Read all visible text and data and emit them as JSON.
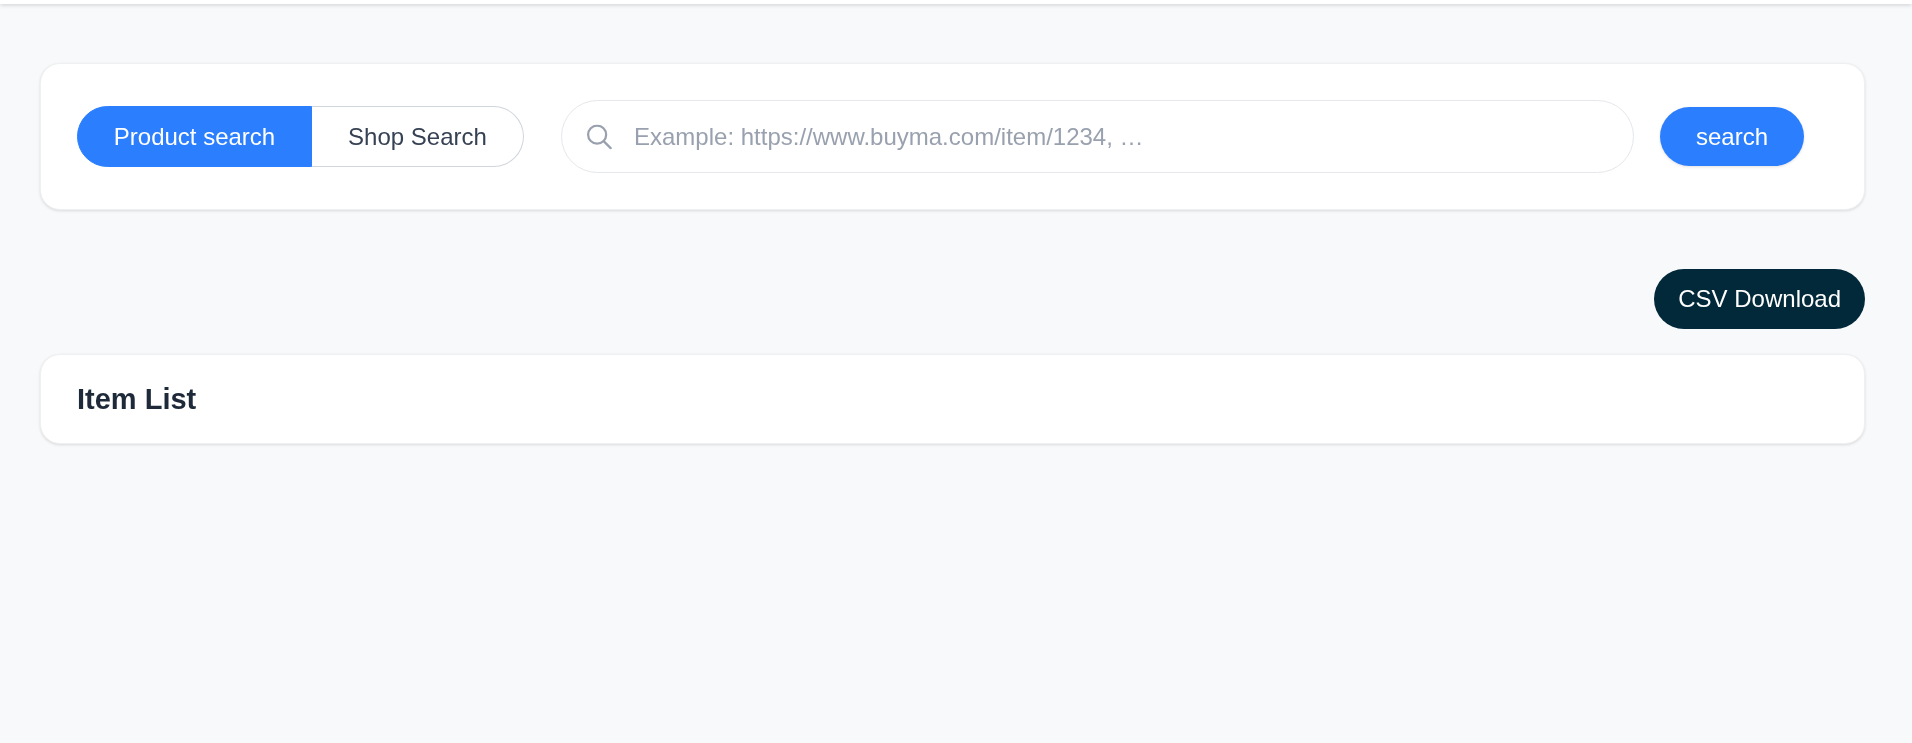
{
  "search_panel": {
    "modes": [
      {
        "label": "Product search",
        "selected": true
      },
      {
        "label": "Shop Search",
        "selected": false
      }
    ],
    "search_field": {
      "placeholder": "Example: https://www.buyma.com/item/1234, …"
    },
    "search_button": "search"
  },
  "csv_button": "CSV Download",
  "item_list": {
    "title": "Item List"
  }
}
